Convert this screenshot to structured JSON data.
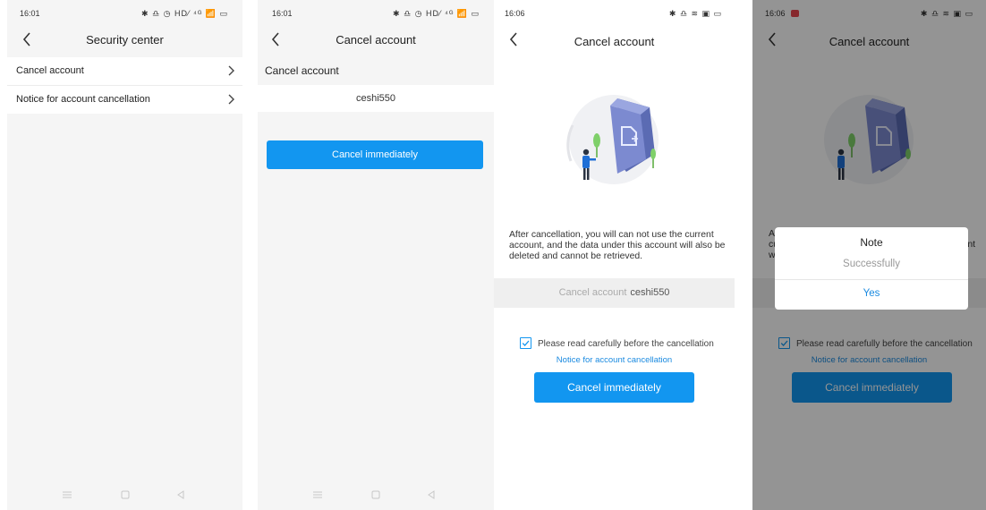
{
  "screen1": {
    "time": "16:01",
    "status_icons": "✱ ♎ ◷ HD⁄ ⁴ᴳ 📶 ▭",
    "title": "Security center",
    "items": [
      {
        "label": "Cancel account"
      },
      {
        "label": "Notice for account cancellation"
      }
    ]
  },
  "screen2": {
    "time": "16:01",
    "status_icons": "✱ ♎ ◷ HD⁄ ⁴ᴳ 📶 ▭",
    "title": "Cancel account",
    "section_label": "Cancel account",
    "account_name": "ceshi550",
    "button_label": "Cancel immediately"
  },
  "screen3": {
    "time": "16:06",
    "status_icons": "✱ ♎ ≋ ▣ ▭",
    "title": "Cancel account",
    "body_text": "After cancellation, you will can not use the current account, and the data under this account will also be deleted and cannot be retrieved.",
    "account_label": "Cancel account",
    "account_name": "ceshi550",
    "agree_text": "Please read carefully before the cancellation",
    "agree_checked": true,
    "notice_link": "Notice for account cancellation",
    "button_label": "Cancel immediately"
  },
  "screen4": {
    "time": "16:06",
    "status_icons": "✱ ♎ ≋ ▣ ▭",
    "title": "Cancel account",
    "agree_text": "Please read carefully before the cancellation",
    "notice_link": "Notice for account cancellation",
    "button_label": "Cancel immediately",
    "dialog": {
      "title": "Note",
      "message": "Successfully",
      "confirm_label": "Yes"
    },
    "peek_left_1": "Af",
    "peek_left_2": "cu",
    "peek_left_3": "w",
    "peek_right": "nt"
  },
  "colors": {
    "accent": "#1296f0",
    "link": "#1a8ae0",
    "page_bg": "#f5f5f5",
    "overlay": "rgba(0,0,0,0.42)"
  },
  "icons": {
    "back": "back-arrow-icon",
    "chevron": "chevron-right-icon",
    "checkbox": "checkbox-checked-icon",
    "nav_menu": "menu-icon",
    "nav_home": "home-square-icon",
    "nav_back": "back-triangle-icon"
  }
}
